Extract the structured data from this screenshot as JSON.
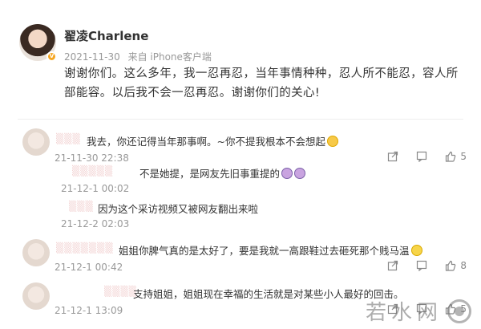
{
  "post": {
    "username": "翟凌Charlene",
    "timestamp": "2021-11-30",
    "source": "来自 iPhone客户端",
    "text": "谢谢你们。这么多年，我一忍再忍，当年事情种种，忍人所不能忍，容人所部能容。以后我不会一忍再忍。谢谢你们的关心!",
    "verified_badge_color": "#f5a623"
  },
  "comments": [
    {
      "text": "我去，你还记得当年那事啊。~你不提我根本不会想起",
      "emoji": "laugh",
      "date": "21-11-30 22:38",
      "likes": "5"
    },
    {
      "text": "不是她提，是网友先旧事重提的",
      "emoji": "face",
      "date": "21-12-1 00:02",
      "likes": ""
    },
    {
      "text": "因为这个采访视频又被网友翻出来啦",
      "emoji": "",
      "date": "21-12-2 02:03",
      "likes": ""
    },
    {
      "text": "姐姐你脾气真的是太好了，要是我就一高跟鞋过去砸死那个贱马温",
      "emoji": "smile",
      "date": "21-12-1 00:42",
      "likes": "8"
    },
    {
      "text": "支持姐姐，姐姐现在幸福的生活就是对某些小人最好的回击。",
      "emoji": "",
      "date": "21-12-1 13:09",
      "likes": "5"
    }
  ],
  "icons": {
    "share": "share-icon",
    "comment": "comment-icon",
    "like": "like-icon"
  },
  "watermark": {
    "text": "若水网",
    "logo": "watermark-logo"
  }
}
